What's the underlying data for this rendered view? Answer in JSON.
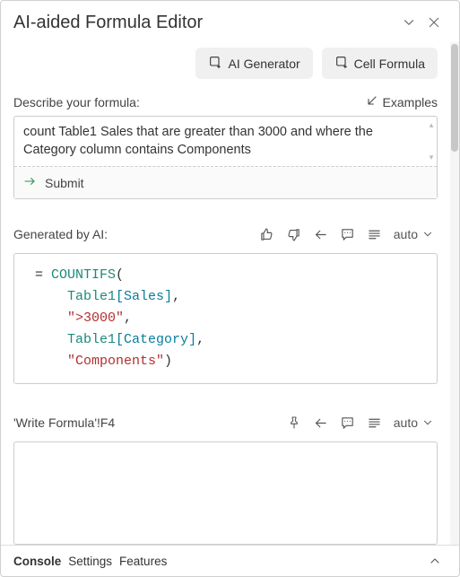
{
  "title": "AI-aided Formula Editor",
  "toolbar": {
    "ai_generator": "AI Generator",
    "cell_formula": "Cell Formula"
  },
  "describe": {
    "label": "Describe your formula:",
    "examples": "Examples",
    "value": "count Table1 Sales that are greater than 3000 and where the Category column contains Components",
    "submit": "Submit"
  },
  "generated": {
    "label": "Generated by AI:",
    "auto": "auto",
    "formula": {
      "fn": "COUNTIFS",
      "arg1_table": "Table1",
      "arg1_col": "Sales",
      "arg2": "\">3000\"",
      "arg3_table": "Table1",
      "arg3_col": "Category",
      "arg4": "\"Components\""
    }
  },
  "target": {
    "label": "'Write Formula'!F4",
    "auto": "auto"
  },
  "footer": {
    "console": "Console",
    "settings": "Settings",
    "features": "Features"
  }
}
